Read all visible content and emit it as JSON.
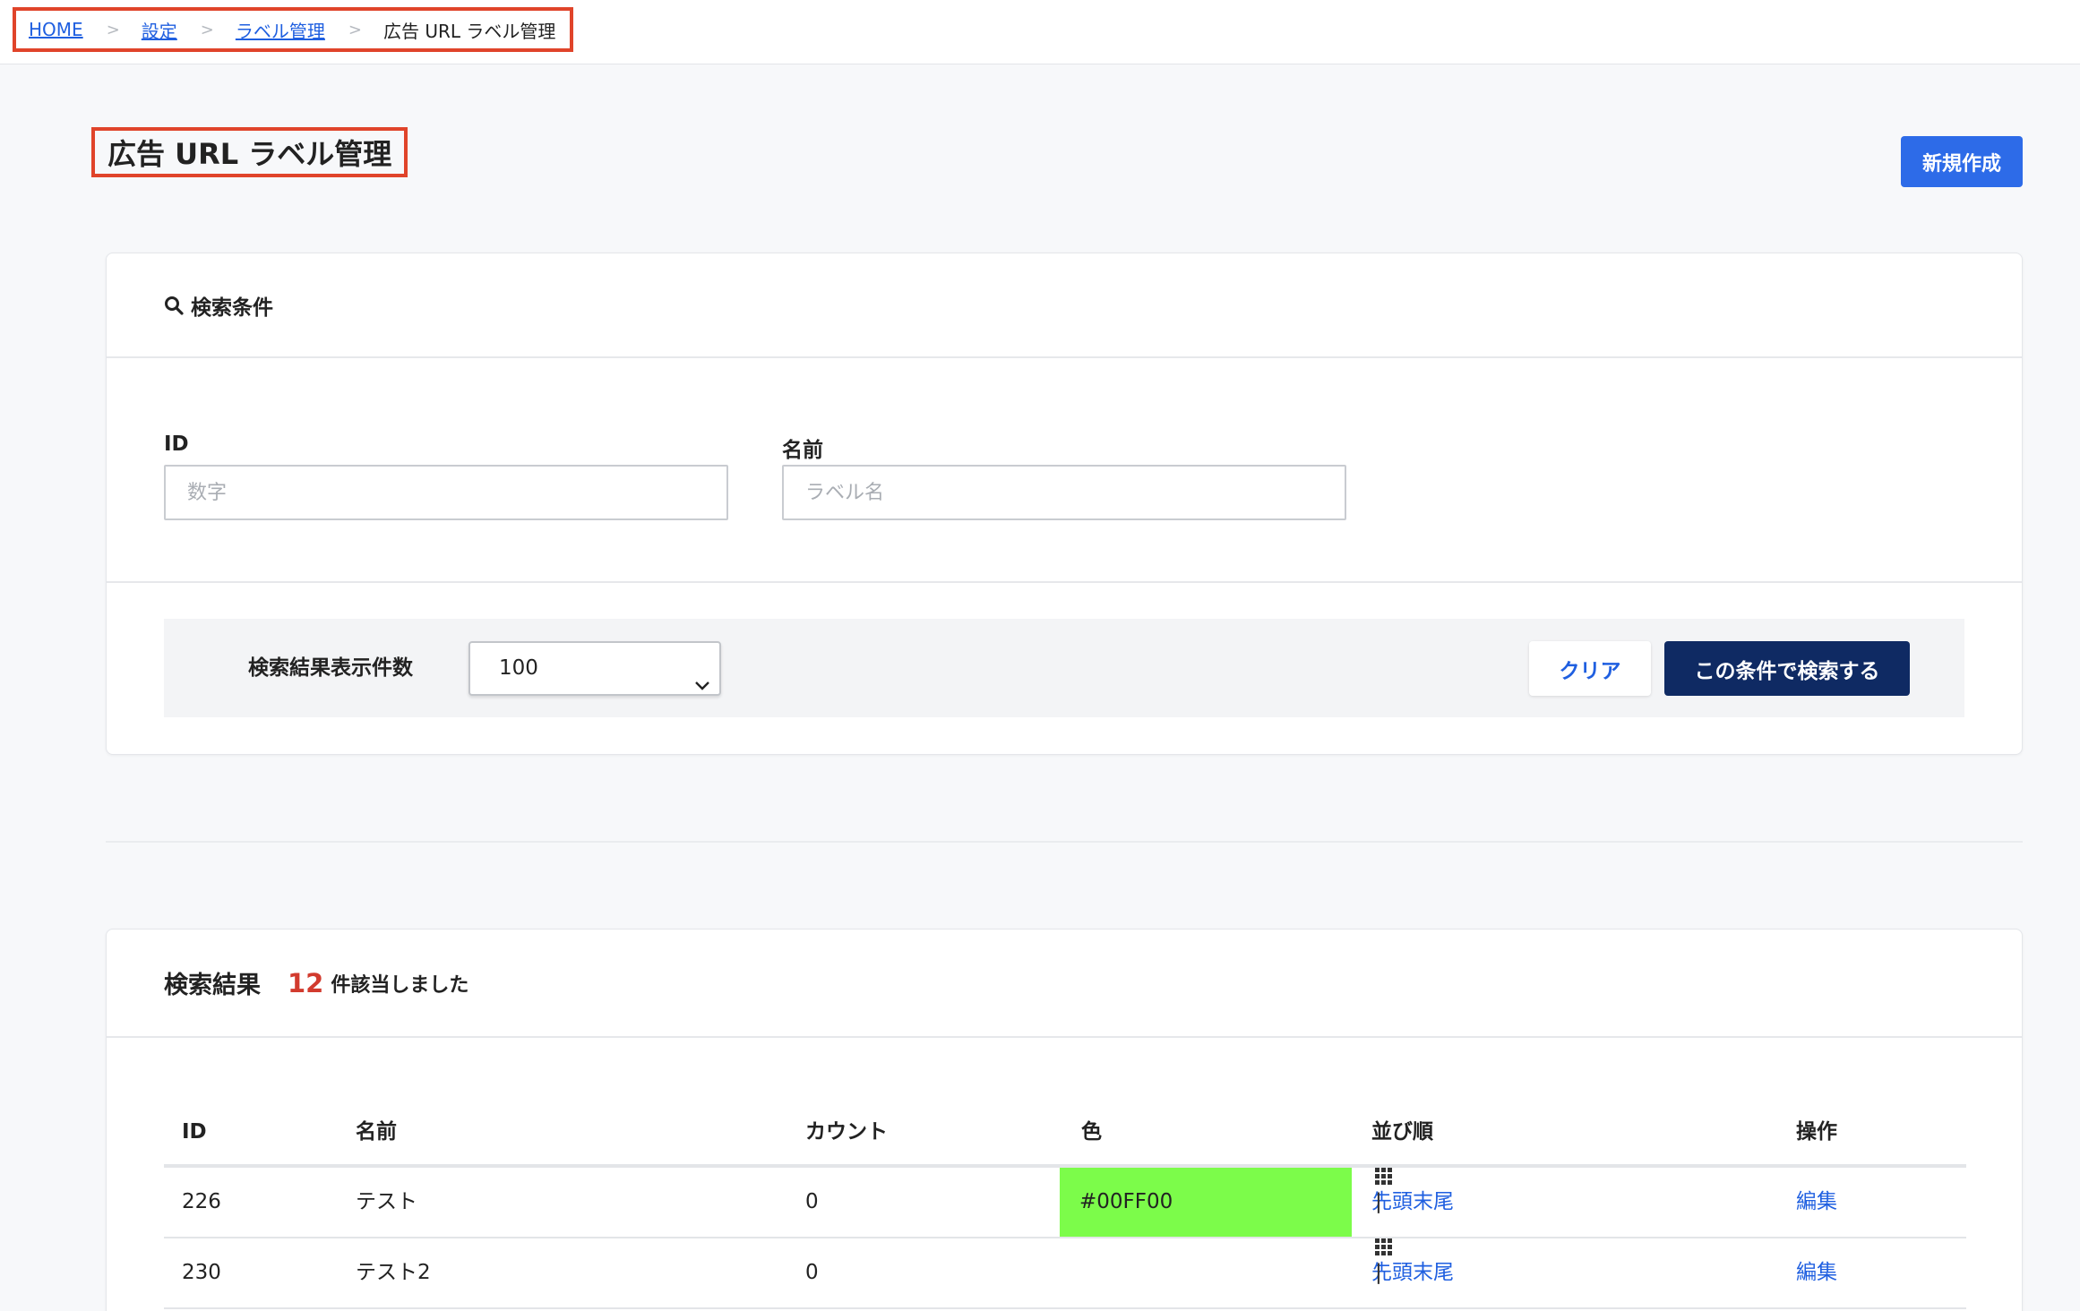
{
  "breadcrumb": {
    "home": "HOME",
    "settings": "設定",
    "label_mgmt": "ラベル管理",
    "current": "広告 URL ラベル管理",
    "separator": ">"
  },
  "page": {
    "title": "広告 URL ラベル管理",
    "new_button": "新規作成"
  },
  "search": {
    "header": "検索条件",
    "id_label": "ID",
    "id_placeholder": "数字",
    "id_value": "",
    "name_label": "名前",
    "name_placeholder": "ラベル名",
    "name_value": "",
    "per_page_label": "検索結果表示件数",
    "per_page_value": "100",
    "clear_button": "クリア",
    "submit_button": "この条件で検索する"
  },
  "results": {
    "title": "検索結果",
    "count": "12",
    "count_suffix": "件該当しました",
    "columns": {
      "id": "ID",
      "name": "名前",
      "count": "カウント",
      "color": "色",
      "order": "並び順",
      "operation": "操作"
    },
    "order_first": "先頭",
    "order_last": "末尾",
    "order_sep": "|",
    "edit": "編集",
    "rows": [
      {
        "id": "226",
        "name": "テスト",
        "count": "0",
        "color": "#00FF00",
        "swatch": "#7cfc4a"
      },
      {
        "id": "230",
        "name": "テスト2",
        "count": "0",
        "color": "",
        "swatch": ""
      }
    ]
  },
  "colors": {
    "accent": "#2d6be8",
    "link": "#1f5fe0",
    "primary_dark": "#0f2a63",
    "highlight_border": "#e0442a",
    "count_red": "#d23b2e"
  },
  "icons": {
    "search": "search-icon",
    "dropdown": "chevron-down-icon",
    "drag": "grid-drag-icon"
  }
}
